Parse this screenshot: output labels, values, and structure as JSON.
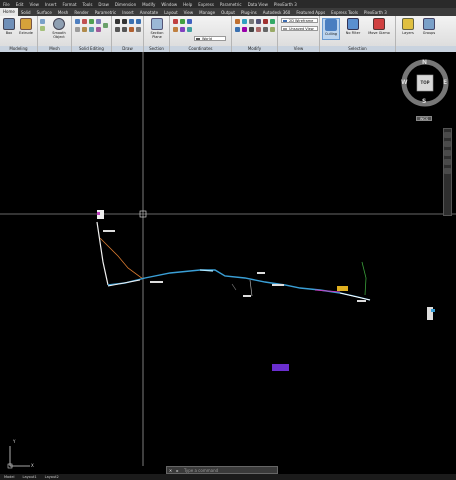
{
  "menubar": [
    "File",
    "Edit",
    "View",
    "Insert",
    "Format",
    "Tools",
    "Draw",
    "Dimension",
    "Modify",
    "Window",
    "Help",
    "Express",
    "Parametric",
    "Data View",
    "PlexEarth 3"
  ],
  "tabs": [
    "Home",
    "Solid",
    "Surface",
    "Mesh",
    "Render",
    "Parametric",
    "Insert",
    "Annotate",
    "Layout",
    "View",
    "Manage",
    "Output",
    "Plug-ins",
    "Autodesk 360",
    "Featured Apps",
    "Express Tools",
    "PlexEarth 3"
  ],
  "active_tab": "Home",
  "ribbon": {
    "groups": [
      {
        "label": "Modeling",
        "buttons": [
          "Box",
          "Extrude"
        ]
      },
      {
        "label": "Mesh",
        "buttons": [
          "Smooth Object"
        ]
      },
      {
        "label": "Solid Editing",
        "buttons": []
      },
      {
        "label": "Draw",
        "buttons": []
      },
      {
        "label": "Section",
        "buttons": [
          "Section Plane"
        ]
      },
      {
        "label": "Coordinates",
        "buttons": []
      },
      {
        "label": "Modify",
        "buttons": []
      },
      {
        "label": "View",
        "buttons": []
      },
      {
        "label": "Selection",
        "buttons": [
          "Culling",
          "No Filter",
          "Move Gizmo"
        ]
      },
      {
        "label": "",
        "buttons": [
          "Layers",
          "Groups"
        ]
      }
    ],
    "visual_style": "2D Wireframe",
    "saved_view": "Unsaved View",
    "ucs": "World"
  },
  "viewcube": {
    "north": "N",
    "south": "S",
    "east": "E",
    "west": "W",
    "face": "TOP",
    "wcs": "WCS"
  },
  "ucs_icon": {
    "x": "X",
    "y": "Y"
  },
  "command_line": {
    "close": "✕",
    "prompt_icon": "▸",
    "placeholder": "Type a command"
  },
  "status": [
    "Model",
    "Layout1",
    "Layout2"
  ],
  "colors": {
    "background": "#000000",
    "ribbon": "#e6e6e6",
    "accent": "#3a8fd0",
    "polyline_main": "#3a9fd6",
    "highlight": "#6a2ecf"
  }
}
